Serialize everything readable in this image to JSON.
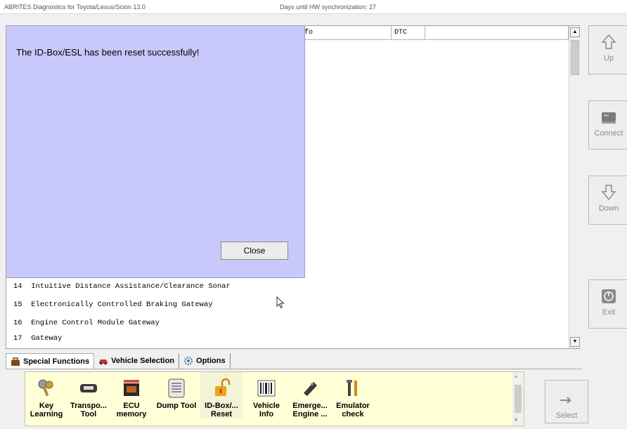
{
  "window": {
    "title": "ABRITES Diagnostics for Toyota/Lexus/Scion 13.0",
    "sync_text": "Days until HW synchronization: 27"
  },
  "list": {
    "columns": [
      "fo",
      "DTC",
      ""
    ],
    "rows": [
      "14  Intuitive Distance Assistance/Clearance Sonar",
      "15  Electronically Controlled Braking Gateway",
      "16  Engine Control Module Gateway",
      "17  Gateway"
    ]
  },
  "dialog": {
    "message": "The ID-Box/ESL has been reset successfully!",
    "close_label": "Close",
    "background": "#c8c8fa"
  },
  "side_buttons": {
    "up": "Up",
    "connect": "Connect",
    "down": "Down",
    "exit": "Exit"
  },
  "tabs": [
    {
      "label": "Special Functions",
      "icon": "toolbox-icon"
    },
    {
      "label": "Vehicle Selection",
      "icon": "car-icon"
    },
    {
      "label": "Options",
      "icon": "gear-icon"
    }
  ],
  "functions": [
    {
      "line1": "Key",
      "line2": "Learning",
      "icon": "keys-icon"
    },
    {
      "line1": "Transpo...",
      "line2": "Tool",
      "icon": "transponder-icon"
    },
    {
      "line1": "ECU",
      "line2": "memory",
      "icon": "ecu-icon"
    },
    {
      "line1": "Dump Tool",
      "line2": "",
      "icon": "binary-dump-icon"
    },
    {
      "line1": "ID-Box/...",
      "line2": "Reset",
      "icon": "unlock-icon"
    },
    {
      "line1": "Vehicle",
      "line2": "Info",
      "icon": "barcode-icon"
    },
    {
      "line1": "Emerge...",
      "line2": "Engine ...",
      "icon": "emergency-key-icon"
    },
    {
      "line1": "Emulator",
      "line2": "check",
      "icon": "tools-icon"
    }
  ],
  "select_label": "Select"
}
